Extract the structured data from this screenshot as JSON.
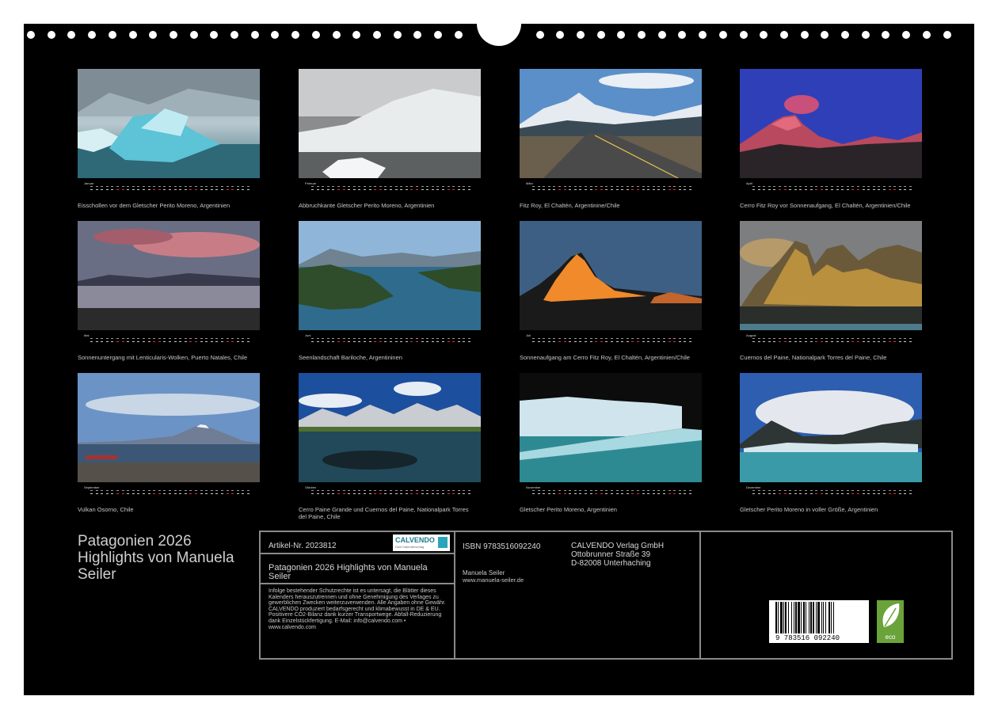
{
  "months": [
    {
      "label": "Januar",
      "caption": "Eisschollen vor dem Gletscher Perito Moreno, Argentinien"
    },
    {
      "label": "Februar",
      "caption": "Abbruchkante Gletscher Perito Moreno, Argentinien"
    },
    {
      "label": "März",
      "caption": "Fitz Roy, El Chaltén, Argentinine/Chile"
    },
    {
      "label": "April",
      "caption": "Cerro Fitz Roy vor Sonnenaufgang, El Chaltén, Argentinien/Chile"
    },
    {
      "label": "Mai",
      "caption": "Sonnenuntergang mit Lenticularis-Wolken, Puerto Natales, Chile"
    },
    {
      "label": "Juni",
      "caption": "Seenlandschaft Bariloche, Argentininen"
    },
    {
      "label": "Juli",
      "caption": "Sonnenaufgang am Cerro Fitz Roy, El Chaltén, Argentinien/Chile"
    },
    {
      "label": "August",
      "caption": "Cuernos del Paine, Nationalpark Torres del Paine, Chile"
    },
    {
      "label": "September",
      "caption": "Vulkan Osorno, Chile"
    },
    {
      "label": "Oktober",
      "caption": "Cerro Paine Grande und Cuernos del Paine, Nationalpark Torres del Paine, Chile"
    },
    {
      "label": "November",
      "caption": "Gletscher Perito Moreno, Argentinien"
    },
    {
      "label": "Dezember",
      "caption": "Gletscher Perito Moreno in voller Größe, Argentinien"
    }
  ],
  "title": "Patagonien 2026 Highlights von Manuela Seiler",
  "info": {
    "artikel": "Artikel-Nr. 2023812",
    "logo": "CALVENDO",
    "logo_sub": "Dein Kalenderverlag",
    "title": "Patagonien 2026 Highlights von Manuela Seiler",
    "legal": "Infolge bestehender Schutzrechte ist es untersagt, die Blätter dieses Kalenders herauszutrennen und ohne Genehmigung des Verlages zu gewerblichen Zwecken weiterzuverwenden. Alle Angaben ohne Gewähr. CALVENDO produziert bedarfsgerecht und klimabewusst in DE & EU. Positivere CO2-Bilanz dank kurzer Transportwege. Abfall-Reduzierung dank Einzelstückfertigung. E-Mail: info@calvendo.com • www.calvendo.com",
    "isbn": "ISBN 9783516092240",
    "author": "Manuela Seiler",
    "website": "www.manuela-seiler.de",
    "publisher_name": "CALVENDO Verlag GmbH",
    "publisher_street": "Ottobrunner Straße 39",
    "publisher_city": "D-82008 Unterhaching",
    "barcode_text": "9 783516 092240",
    "eco_label": "eco"
  },
  "colors": {
    "background": "#000000",
    "border": "#8a8a8a",
    "text": "#cfcfcf",
    "eco": "#6aa33a"
  }
}
